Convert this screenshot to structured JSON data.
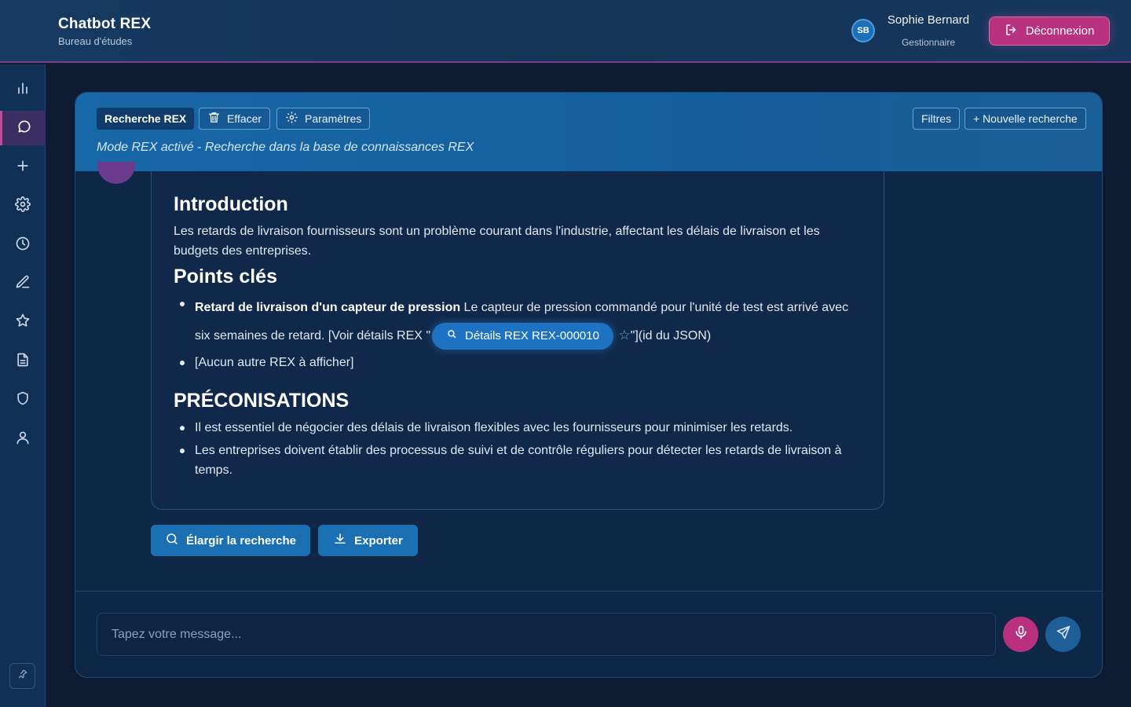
{
  "header": {
    "app_title": "Chatbot REX",
    "app_subtitle": "Bureau d'études",
    "user_initials": "SB",
    "user_name": "Sophie Bernard",
    "user_role": "Gestionnaire",
    "logout_label": "Déconnexion"
  },
  "sidebar": {
    "items": [
      {
        "name": "stats",
        "icon": "bar-chart-icon"
      },
      {
        "name": "chat",
        "icon": "chat-bubble-icon",
        "active": true
      },
      {
        "name": "new",
        "icon": "plus-icon"
      },
      {
        "name": "settings",
        "icon": "gear-icon"
      },
      {
        "name": "history",
        "icon": "clock-icon"
      },
      {
        "name": "edit",
        "icon": "pen-icon"
      },
      {
        "name": "favorites",
        "icon": "star-icon"
      },
      {
        "name": "documents",
        "icon": "document-icon"
      },
      {
        "name": "security",
        "icon": "shield-icon"
      },
      {
        "name": "profile",
        "icon": "user-icon"
      }
    ],
    "pin_icon": "pin-icon"
  },
  "toolbar": {
    "rex_label": "Recherche REX",
    "clear_label": "Effacer",
    "params_label": "Paramètres",
    "filters_label": "Filtres",
    "new_search_label": "+ Nouvelle recherche",
    "mode_text": "Mode REX activé - Recherche dans la base de connaissances REX"
  },
  "message": {
    "intro_title": "Introduction",
    "intro_text": "Les retards de livraison fournisseurs sont un problème courant dans l'industrie, affectant les délais de livraison et les budgets des entreprises.",
    "points_title": "Points clés",
    "point1_bold": "Retard de livraison d'un capteur de pression",
    "point1_text": " Le capteur de pression commandé pour l'unité de test est arrivé avec six semaines de retard. [Voir détails REX \"",
    "point1_link": "Détails REX REX-000010",
    "point1_tail": "\"](id du JSON)",
    "point2_text": "[Aucun autre REX à afficher]",
    "reco_title": "PRÉCONISATIONS",
    "reco1": "Il est essentiel de négocier des délais de livraison flexibles avec les fournisseurs pour minimiser les retards.",
    "reco2": "Les entreprises doivent établir des processus de suivi et de contrôle réguliers pour détecter les retards de livraison à temps."
  },
  "actions": {
    "broaden_label": "Élargir la recherche",
    "export_label": "Exporter"
  },
  "composer": {
    "placeholder": "Tapez votre message...",
    "value": ""
  },
  "colors": {
    "accent_pink": "#b8327f",
    "accent_blue": "#1a70b3",
    "background": "#0d1b33"
  }
}
